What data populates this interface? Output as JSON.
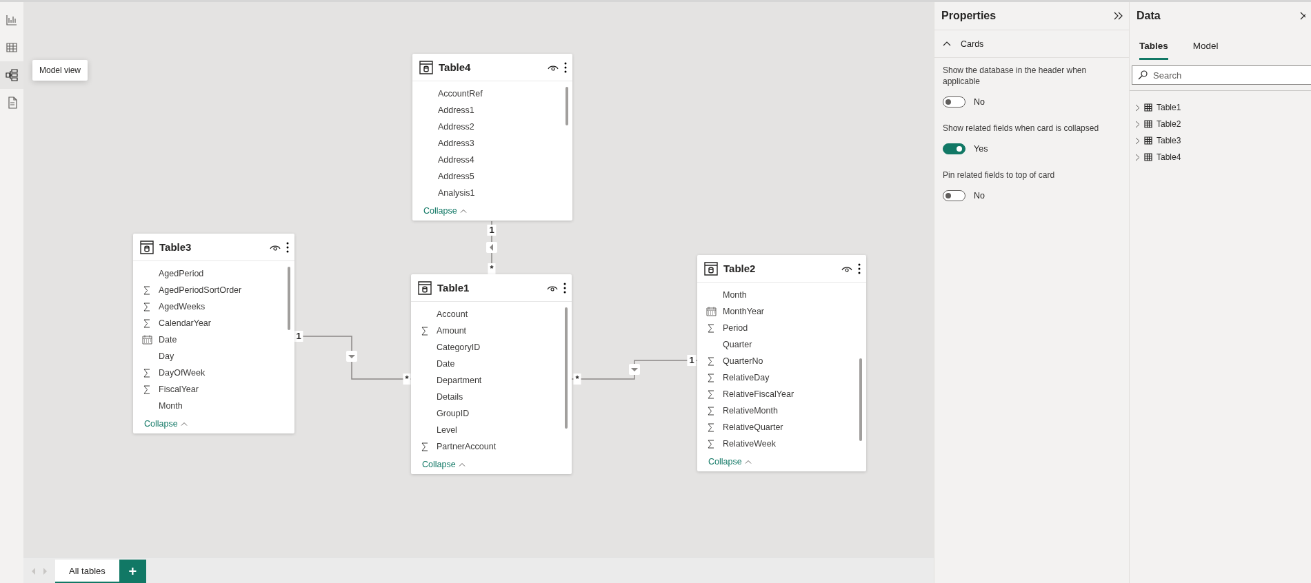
{
  "rail": {
    "items": [
      {
        "kind": "report",
        "selected": false
      },
      {
        "kind": "table",
        "selected": false
      },
      {
        "kind": "model",
        "selected": true
      },
      {
        "kind": "dax",
        "selected": false
      }
    ],
    "tooltip": "Model view"
  },
  "canvas": {
    "cards": [
      {
        "title": "Table4",
        "fields": [
          {
            "name": "AccountRef",
            "kind": "text"
          },
          {
            "name": "Address1",
            "kind": "text"
          },
          {
            "name": "Address2",
            "kind": "text"
          },
          {
            "name": "Address3",
            "kind": "text"
          },
          {
            "name": "Address4",
            "kind": "text"
          },
          {
            "name": "Address5",
            "kind": "text"
          },
          {
            "name": "Analysis1",
            "kind": "text"
          }
        ],
        "collapse": "Collapse"
      },
      {
        "title": "Table3",
        "fields": [
          {
            "name": "AgedPeriod",
            "kind": "text"
          },
          {
            "name": "AgedPeriodSortOrder",
            "kind": "sum"
          },
          {
            "name": "AgedWeeks",
            "kind": "sum"
          },
          {
            "name": "CalendarYear",
            "kind": "sum"
          },
          {
            "name": "Date",
            "kind": "date"
          },
          {
            "name": "Day",
            "kind": "text"
          },
          {
            "name": "DayOfWeek",
            "kind": "sum"
          },
          {
            "name": "FiscalYear",
            "kind": "sum"
          },
          {
            "name": "Month",
            "kind": "text"
          }
        ],
        "collapse": "Collapse"
      },
      {
        "title": "Table1",
        "fields": [
          {
            "name": "Account",
            "kind": "text"
          },
          {
            "name": "Amount",
            "kind": "sum"
          },
          {
            "name": "CategoryID",
            "kind": "text"
          },
          {
            "name": "Date",
            "kind": "text"
          },
          {
            "name": "Department",
            "kind": "text"
          },
          {
            "name": "Details",
            "kind": "text"
          },
          {
            "name": "GroupID",
            "kind": "text"
          },
          {
            "name": "Level",
            "kind": "text"
          },
          {
            "name": "PartnerAccount",
            "kind": "sum"
          }
        ],
        "collapse": "Collapse"
      },
      {
        "title": "Table2",
        "fields": [
          {
            "name": "Month",
            "kind": "text"
          },
          {
            "name": "MonthYear",
            "kind": "date"
          },
          {
            "name": "Period",
            "kind": "sum"
          },
          {
            "name": "Quarter",
            "kind": "text"
          },
          {
            "name": "QuarterNo",
            "kind": "sum"
          },
          {
            "name": "RelativeDay",
            "kind": "sum"
          },
          {
            "name": "RelativeFiscalYear",
            "kind": "sum"
          },
          {
            "name": "RelativeMonth",
            "kind": "sum"
          },
          {
            "name": "RelativeQuarter",
            "kind": "sum"
          },
          {
            "name": "RelativeWeek",
            "kind": "sum"
          }
        ],
        "collapse": "Collapse"
      }
    ],
    "relationships": [
      {
        "one": "1",
        "many": "*"
      },
      {
        "one": "1",
        "many": "*"
      },
      {
        "one": "1",
        "many": "*"
      }
    ]
  },
  "properties": {
    "title": "Properties",
    "section": {
      "label": "Cards",
      "expanded": true
    },
    "settings": [
      {
        "label": "Show the database in the header when applicable",
        "on": false,
        "value": "No"
      },
      {
        "label": "Show related fields when card is collapsed",
        "on": true,
        "value": "Yes"
      },
      {
        "label": "Pin related fields to top of card",
        "on": false,
        "value": "No"
      }
    ]
  },
  "data": {
    "title": "Data",
    "tabs": [
      {
        "label": "Tables",
        "selected": true
      },
      {
        "label": "Model",
        "selected": false
      }
    ],
    "search": {
      "placeholder": "Search"
    },
    "tables": [
      {
        "label": "Table1",
        "expanded": false
      },
      {
        "label": "Table2",
        "expanded": false
      },
      {
        "label": "Table3",
        "expanded": false
      },
      {
        "label": "Table4",
        "expanded": false
      }
    ]
  },
  "bottom": {
    "tabs": [
      {
        "label": "All tables",
        "selected": true
      }
    ],
    "add": "+"
  }
}
